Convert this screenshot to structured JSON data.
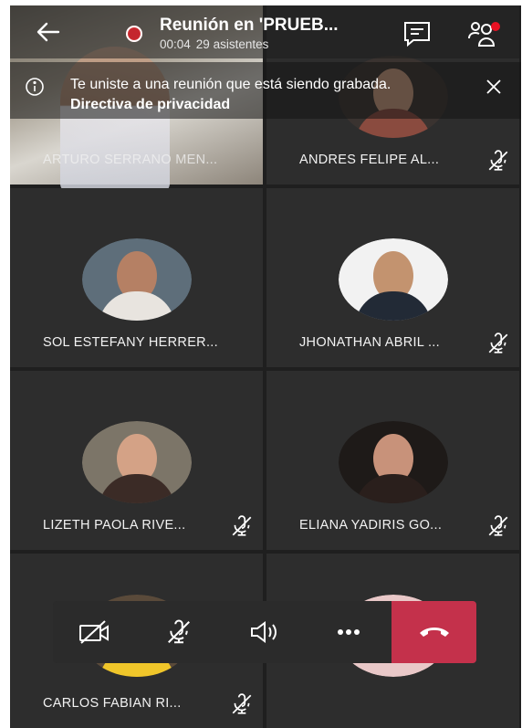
{
  "header": {
    "title": "Reunión en 'PRUEB...",
    "duration": "00:04",
    "attendees": "29 asistentes"
  },
  "banner": {
    "text": "Te uniste a una reunión que está siendo grabada. ",
    "link": "Directiva de privacidad"
  },
  "participants": [
    {
      "name": "ARTURO SERRANO MEN...",
      "muted": false
    },
    {
      "name": "ANDRES FELIPE AL...",
      "muted": true
    },
    {
      "name": "SOL ESTEFANY HERRER...",
      "muted": false
    },
    {
      "name": "JHONATHAN ABRIL ...",
      "muted": true
    },
    {
      "name": "LIZETH PAOLA RIVE...",
      "muted": true
    },
    {
      "name": "ELIANA YADIRIS  GO...",
      "muted": true
    },
    {
      "name": "CARLOS FABIAN RI...",
      "muted": true
    }
  ],
  "colors": {
    "accent_hangup": "#c4314b",
    "recording": "#d13438",
    "badge": "#e81123"
  },
  "icons": [
    "back-arrow-icon",
    "recording-icon",
    "chat-icon",
    "participants-icon",
    "info-icon",
    "close-icon",
    "camera-off-icon",
    "mic-off-icon",
    "speaker-icon",
    "more-icon",
    "hangup-icon"
  ]
}
